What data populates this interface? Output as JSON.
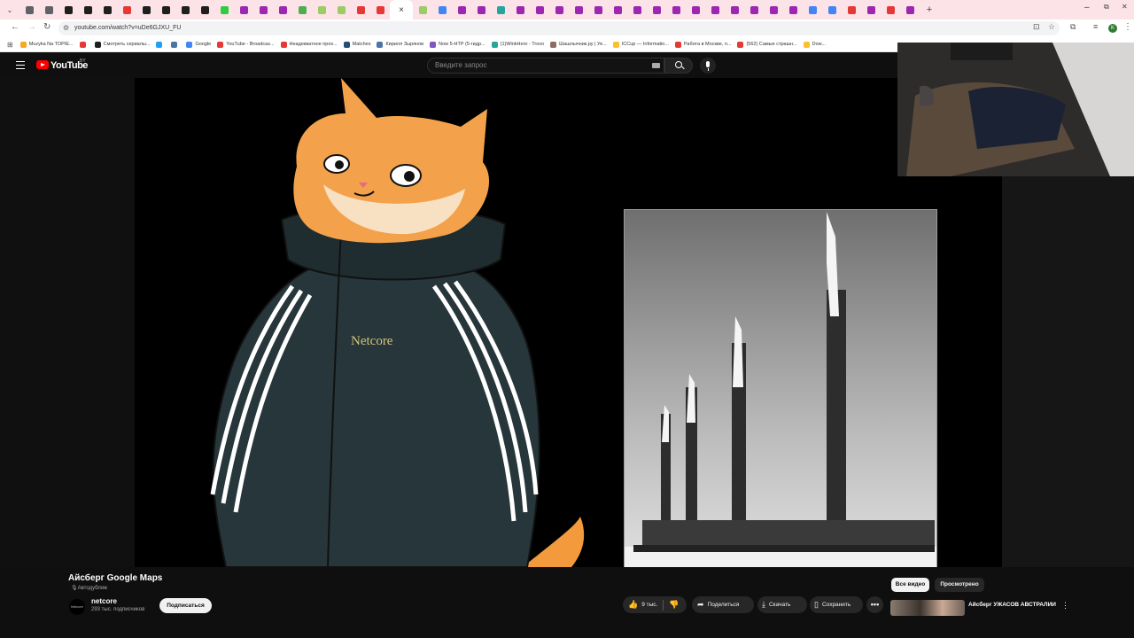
{
  "browser": {
    "tab_favicons": [
      "#5f6368",
      "#5f6368",
      "#1f1f1f",
      "#1f1f1f",
      "#1f1f1f",
      "#e53935",
      "#1f1f1f",
      "#1f1f1f",
      "#1f1f1f",
      "#1f1f1f",
      "#2ecc40",
      "#9c27b0",
      "#9c27b0",
      "#9c27b0",
      "#4caf50",
      "#9ccc65",
      "#9ccc65",
      "#e53935",
      "#e53935"
    ],
    "tab_favicons_after": [
      "#9ccc65",
      "#4285f4",
      "#9c27b0",
      "#9c27b0",
      "#26a69a",
      "#9c27b0",
      "#9c27b0",
      "#9c27b0",
      "#9c27b0",
      "#9c27b0",
      "#9c27b0",
      "#9c27b0",
      "#9c27b0",
      "#9c27b0",
      "#9c27b0",
      "#9c27b0",
      "#9c27b0",
      "#9c27b0",
      "#9c27b0",
      "#9c27b0",
      "#4285f4",
      "#4285f4",
      "#e53935",
      "#9c27b0",
      "#e53935",
      "#9c27b0"
    ],
    "active_tab_close": "×",
    "new_tab": "+",
    "url": "youtube.com/watch?v=uDe6GJXU_FU",
    "window_minimize": "–",
    "window_maximize": "⧉",
    "window_close": "✕",
    "profile_initial": "K",
    "bookmarks": [
      {
        "label": "Muzyka Na TOPIE...",
        "color": "#f9a825"
      },
      {
        "label": "",
        "color": "#e53935"
      },
      {
        "label": "Смотреть сериалы...",
        "color": "#1f1f1f"
      },
      {
        "label": "",
        "color": "#1da1f2"
      },
      {
        "label": "",
        "color": "#4c75a3"
      },
      {
        "label": "Google",
        "color": "#4285f4"
      },
      {
        "label": "YouTube - Broadcas...",
        "color": "#e53935"
      },
      {
        "label": "Неадекватное прох...",
        "color": "#e53935"
      },
      {
        "label": "Matches",
        "color": "#1f4e79"
      },
      {
        "label": "Кирилл Зырянов",
        "color": "#4c75a3"
      },
      {
        "label": "Now 5-HTP (5-гидр...",
        "color": "#7e57c2"
      },
      {
        "label": "(1)WinkHero - Trovo",
        "color": "#26a69a"
      },
      {
        "label": "Шашлычник.ру | Уе...",
        "color": "#8d6e63"
      },
      {
        "label": "ICCup — Informatio...",
        "color": "#fbc02d"
      },
      {
        "label": "Работа в Москве, п...",
        "color": "#e53935"
      },
      {
        "label": "(562) Самые страшн...",
        "color": "#e53935"
      },
      {
        "label": "Dow...",
        "color": "#fbc02d"
      }
    ]
  },
  "youtube": {
    "logo_text": "YouTube",
    "country_code": "BY",
    "search_placeholder": "Введите запрос",
    "video": {
      "title": "Айсберг Google Maps",
      "autodub": "Автодубляж",
      "jacket_brand": "Netcore"
    },
    "channel": {
      "avatar_text": "Netcore",
      "name": "netcore",
      "subscribers": "293 тыс. подписчиков",
      "subscribe_label": "Подписаться"
    },
    "actions": {
      "likes": "9 тыс.",
      "share": "Поделиться",
      "download": "Скачать",
      "save": "Сохранить",
      "more": "•••"
    },
    "side_tabs": {
      "all": "Все видео",
      "watched": "Просмотрено"
    },
    "recommendation": {
      "title": "Айсберг УЖАСОВ АВСТРАЛИИ"
    }
  }
}
